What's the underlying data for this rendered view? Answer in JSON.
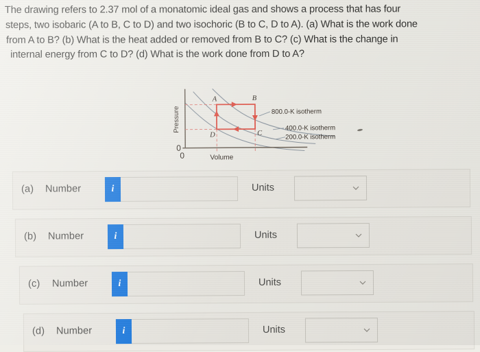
{
  "question": {
    "lines": [
      "The drawing refers to 2.37 mol of a monatomic ideal gas and shows a process that has four",
      "steps, two isobaric (A to B, C to D) and two isochoric (B to C, D to A). (a) What is the work done",
      "from A to B? (b) What is the heat added or removed from B to C? (c) What is the change in",
      "internal energy from C to D? (d) What is the work done from D to A?"
    ],
    "moles": "2.37 mol",
    "gas_type": "monatomic ideal gas"
  },
  "figure": {
    "y_axis_label": "Pressure",
    "x_axis_label": "Volume",
    "origin_label_y": "0",
    "origin_label_x": "0",
    "vertex_labels": [
      "A",
      "B",
      "C",
      "D"
    ],
    "isotherms": [
      {
        "label": "800.0-K isotherm",
        "temperature": "800.0 K"
      },
      {
        "label": "400.0-K isotherm",
        "temperature": "400.0 K"
      },
      {
        "label": "200.0-K isotherm",
        "temperature": "200.0 K"
      }
    ],
    "cycle_colors": {
      "path": "#e2564a",
      "isotherm": "#8e9aa6",
      "axis": "#6e6459",
      "dashed": "#e2827b"
    }
  },
  "answers": [
    {
      "id": "a",
      "label": "(a)",
      "number_label": "Number",
      "info_glyph": "i",
      "value": "",
      "units_label": "Units",
      "units_value": ""
    },
    {
      "id": "b",
      "label": "(b)",
      "number_label": "Number",
      "info_glyph": "i",
      "value": "",
      "units_label": "Units",
      "units_value": ""
    },
    {
      "id": "c",
      "label": "(c)",
      "number_label": "Number",
      "info_glyph": "i",
      "value": "",
      "units_label": "Units",
      "units_value": ""
    },
    {
      "id": "d",
      "label": "(d)",
      "number_label": "Number",
      "info_glyph": "i",
      "value": "",
      "units_label": "Units",
      "units_value": ""
    }
  ]
}
